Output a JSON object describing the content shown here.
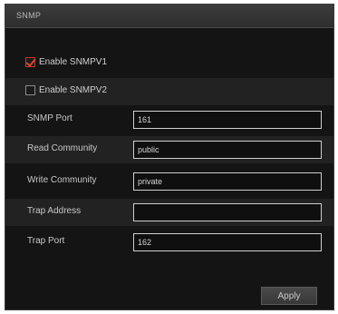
{
  "panel": {
    "title": "SNMP"
  },
  "options": {
    "snmpv1": {
      "label": "Enable SNMPV1",
      "checked": true
    },
    "snmpv2": {
      "label": "Enable SNMPV2",
      "checked": false
    }
  },
  "fields": {
    "snmp_port": {
      "label": "SNMP Port",
      "value": "161"
    },
    "read_community": {
      "label": "Read Community",
      "value": "public"
    },
    "write_community": {
      "label": "Write Community",
      "value": "private"
    },
    "trap_address": {
      "label": "Trap Address",
      "value": ""
    },
    "trap_port": {
      "label": "Trap Port",
      "value": "162"
    }
  },
  "actions": {
    "apply_label": "Apply"
  },
  "colors": {
    "panel_background": "#141414",
    "header_background": "#333333",
    "alternate_row": "#222222",
    "checkbox_check": "#d14836",
    "input_border": "#cfcfcf"
  }
}
